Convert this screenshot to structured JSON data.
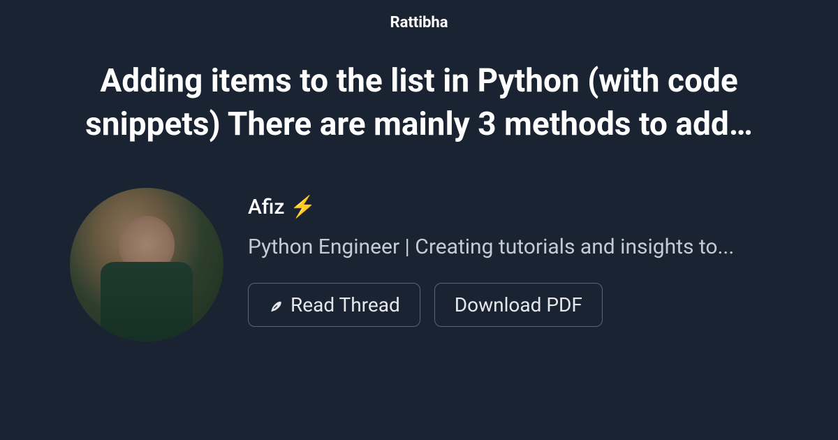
{
  "site_name": "Rattibha",
  "thread_title": "Adding items to the list in Python (with code snippets) There are mainly 3 methods to add…",
  "author": {
    "name": "Afiz",
    "emoji": "⚡",
    "bio": "Python Engineer | Creating tutorials and insights to..."
  },
  "buttons": {
    "read_thread": "Read Thread",
    "download_pdf": "Download PDF"
  },
  "icons": {
    "feather": "feather-icon"
  }
}
